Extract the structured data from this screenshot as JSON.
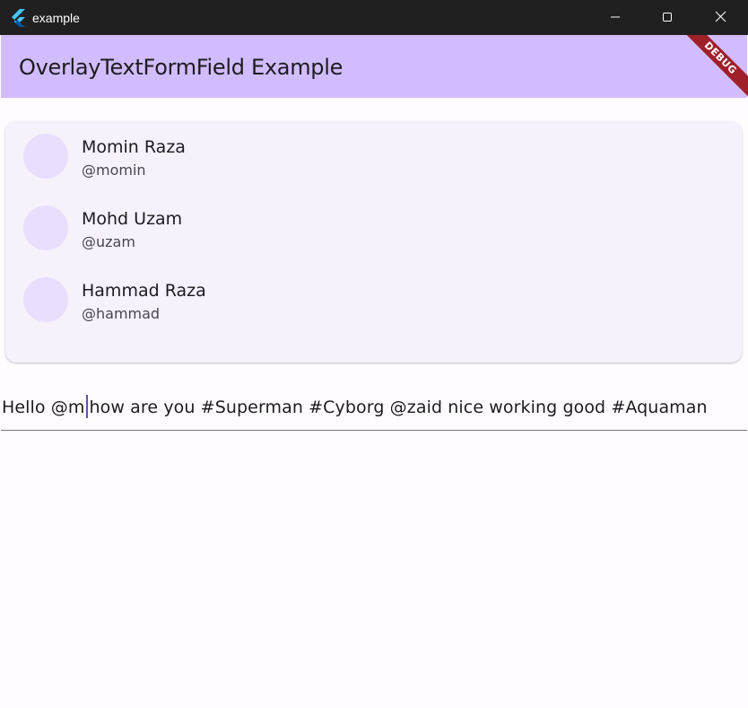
{
  "window": {
    "title": "example",
    "icons": {
      "logo": "flutter-logo-icon",
      "minimize": "minimize-icon",
      "maximize": "maximize-icon",
      "close": "close-icon"
    }
  },
  "appbar": {
    "title": "OverlayTextFormField Example",
    "debug_label": "DEBUG",
    "color": "#d1bcff"
  },
  "suggestions": [
    {
      "name": "Momin Raza",
      "handle": "@momin"
    },
    {
      "name": "Mohd Uzam",
      "handle": "@uzam"
    },
    {
      "name": "Hammad Raza",
      "handle": "@hammad"
    }
  ],
  "text_field": {
    "value_before_caret": "Hello @m",
    "value_after_caret": "how are you #Superman #Cyborg @zaid nice working good #Aquaman"
  },
  "colors": {
    "caret": "#6750a4",
    "card_bg": "#f6f1fa",
    "avatar_bg": "#eadeff",
    "debug_ribbon": "#a0202a"
  }
}
